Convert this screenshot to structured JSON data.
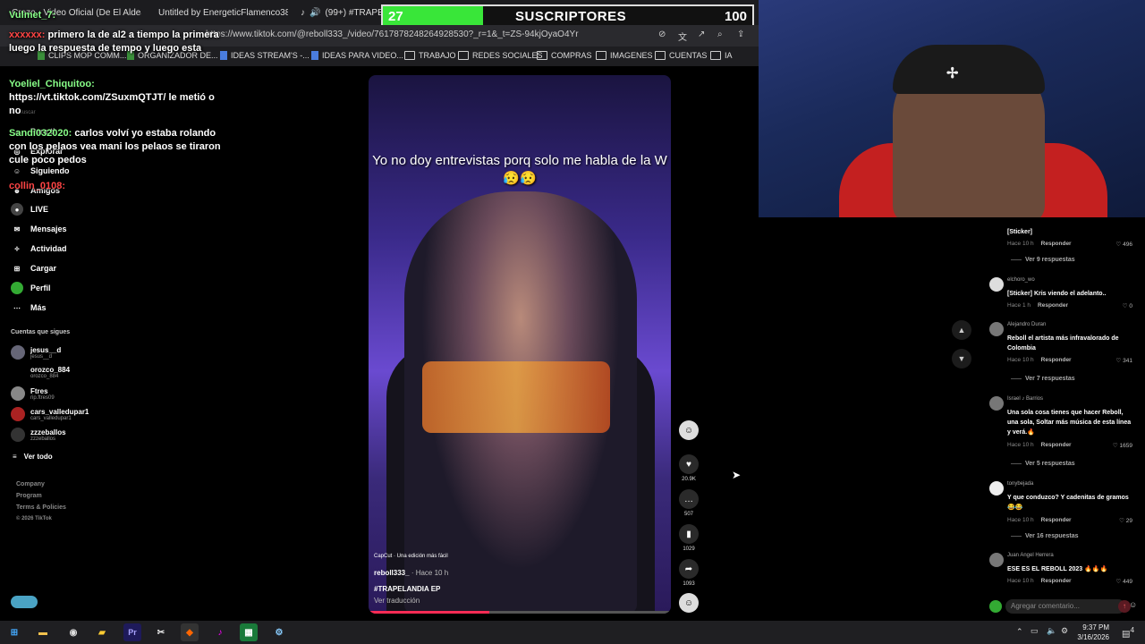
{
  "browser": {
    "tabs": [
      {
        "label": "Crezo - Video Oficial (De El Aldea...",
        "color": "#e33"
      },
      {
        "label": "Untitled by EnergeticFlamenco386 | S...",
        "color": "#e55"
      },
      {
        "label": "(99+) #TRAPELAN...",
        "color": "#fff"
      }
    ],
    "url": "https://www.tiktok.com/@reboll333_/video/7617878248264928530?_r=1&_t=ZS-94kjOyaO4Yr",
    "bookmarks": [
      {
        "label": "CLIPS MOP COMM...",
        "kind": "green"
      },
      {
        "label": "ORGANIZADOR DE...",
        "kind": "green"
      },
      {
        "label": "IDEAS STREAM'S -...",
        "kind": "blue"
      },
      {
        "label": "IDEAS PARA VIDEO...",
        "kind": "blue"
      },
      {
        "label": "TRABAJO",
        "kind": "folder"
      },
      {
        "label": "REDES SOCIALES",
        "kind": "folder"
      },
      {
        "label": "COMPRAS",
        "kind": "folder"
      },
      {
        "label": "IMAGENES",
        "kind": "folder"
      },
      {
        "label": "CUENTAS",
        "kind": "folder"
      },
      {
        "label": "IA",
        "kind": "folder"
      }
    ]
  },
  "subs": {
    "current": "27",
    "title": "SUSCRIPTORES",
    "goal": "100",
    "progress": 0.27,
    "fill_color": "#39e639"
  },
  "chat": [
    {
      "user": "Vulmet_7:",
      "text": ""
    },
    {
      "user": "xxxxxx:",
      "text": "primero la de al2 a tiempo la primera luego la respuesta de tempo y luego esta"
    },
    {
      "user": "Yoeliel_Chiquitoo:",
      "text": "https://vt.tiktok.com/ZSuxmQTJT/ le metió o no"
    },
    {
      "user": "Sandi032020:",
      "text": "carlos volví yo estaba rolando con los pelaos vea mani los pelaos se tiraron cule poco pedos"
    },
    {
      "user": "collin_0108:",
      "text": ""
    }
  ],
  "nav": {
    "items": [
      {
        "label": "Para ti",
        "icon": "home-icon"
      },
      {
        "label": "Explorar",
        "icon": "compass-icon"
      },
      {
        "label": "Siguiendo",
        "icon": "users-icon"
      },
      {
        "label": "Amigos",
        "icon": "friends-icon"
      },
      {
        "label": "LIVE",
        "icon": "live-icon"
      },
      {
        "label": "Mensajes",
        "icon": "message-icon"
      },
      {
        "label": "Actividad",
        "icon": "activity-icon"
      },
      {
        "label": "Cargar",
        "icon": "upload-icon"
      },
      {
        "label": "Perfil",
        "icon": "profile-icon"
      },
      {
        "label": "Más",
        "icon": "more-icon"
      }
    ],
    "search_placeholder": "Buscar",
    "following_title": "Cuentas que sigues",
    "following": [
      {
        "name": "jesus__d",
        "sub": "jesus__d"
      },
      {
        "name": "orozco_884",
        "sub": "orozco_884"
      },
      {
        "name": "Ftres",
        "sub": "rip.ftres09"
      },
      {
        "name": "cars_valledupar1",
        "sub": "cars_valledupar1"
      },
      {
        "name": "zzzeballos",
        "sub": "zzzeballos"
      }
    ],
    "see_all": "Ver todo",
    "footer": [
      "Company",
      "Program",
      "Terms & Policies",
      "© 2026 TikTok"
    ]
  },
  "video": {
    "caption": "Yo no doy entrevistas porq solo me habla de la W 😥😥",
    "capcut": "CapCut · Una edición más fácil",
    "author": "reboll333_",
    "time": "· Hace 10 h",
    "hashtag": "#TRAPELANDIA EP",
    "translate": "Ver traducción",
    "progress": 0.4
  },
  "actions": {
    "likes": "20.9K",
    "comments": "507",
    "saves": "1029",
    "shares": "1093"
  },
  "comments": [
    {
      "user": "",
      "text": "[Sticker]",
      "time": "Hace 10 h",
      "reply": "Responder",
      "likes": "496",
      "more": "Ver 9 respuestas"
    },
    {
      "user": "elchoro_wo",
      "text": "[Sticker] Kris viendo el adelanto..",
      "time": "Hace 1 h",
      "reply": "Responder",
      "likes": "0",
      "more": ""
    },
    {
      "user": "Alejandro Duran",
      "text": "Reboll el artista más infravalorado de Colombia",
      "time": "Hace 10 h",
      "reply": "Responder",
      "likes": "341",
      "more": "Ver 7 respuestas"
    },
    {
      "user": "Israel ♪ Barrios",
      "text": "Una sola cosa tienes que hacer Reboll, una sola, Soltar más música de esta línea y verá.🔥",
      "time": "Hace 10 h",
      "reply": "Responder",
      "likes": "1659",
      "more": "Ver 5 respuestas"
    },
    {
      "user": "tonybejada",
      "text": "Y que conduzco? Y cadenitas de gramos 😂😂",
      "time": "Hace 10 h",
      "reply": "Responder",
      "likes": "29",
      "more": "Ver 16 respuestas"
    },
    {
      "user": "Juan Angel Herrera",
      "text": "ESE ES EL REBOLL 2023 🔥🔥🔥",
      "time": "Hace 10 h",
      "reply": "Responder",
      "likes": "449",
      "more": ""
    }
  ],
  "add_comment_placeholder": "Agregar comentario...",
  "taskbar": {
    "time": "9:37 PM",
    "date": "3/16/2026",
    "notifications": "4"
  }
}
